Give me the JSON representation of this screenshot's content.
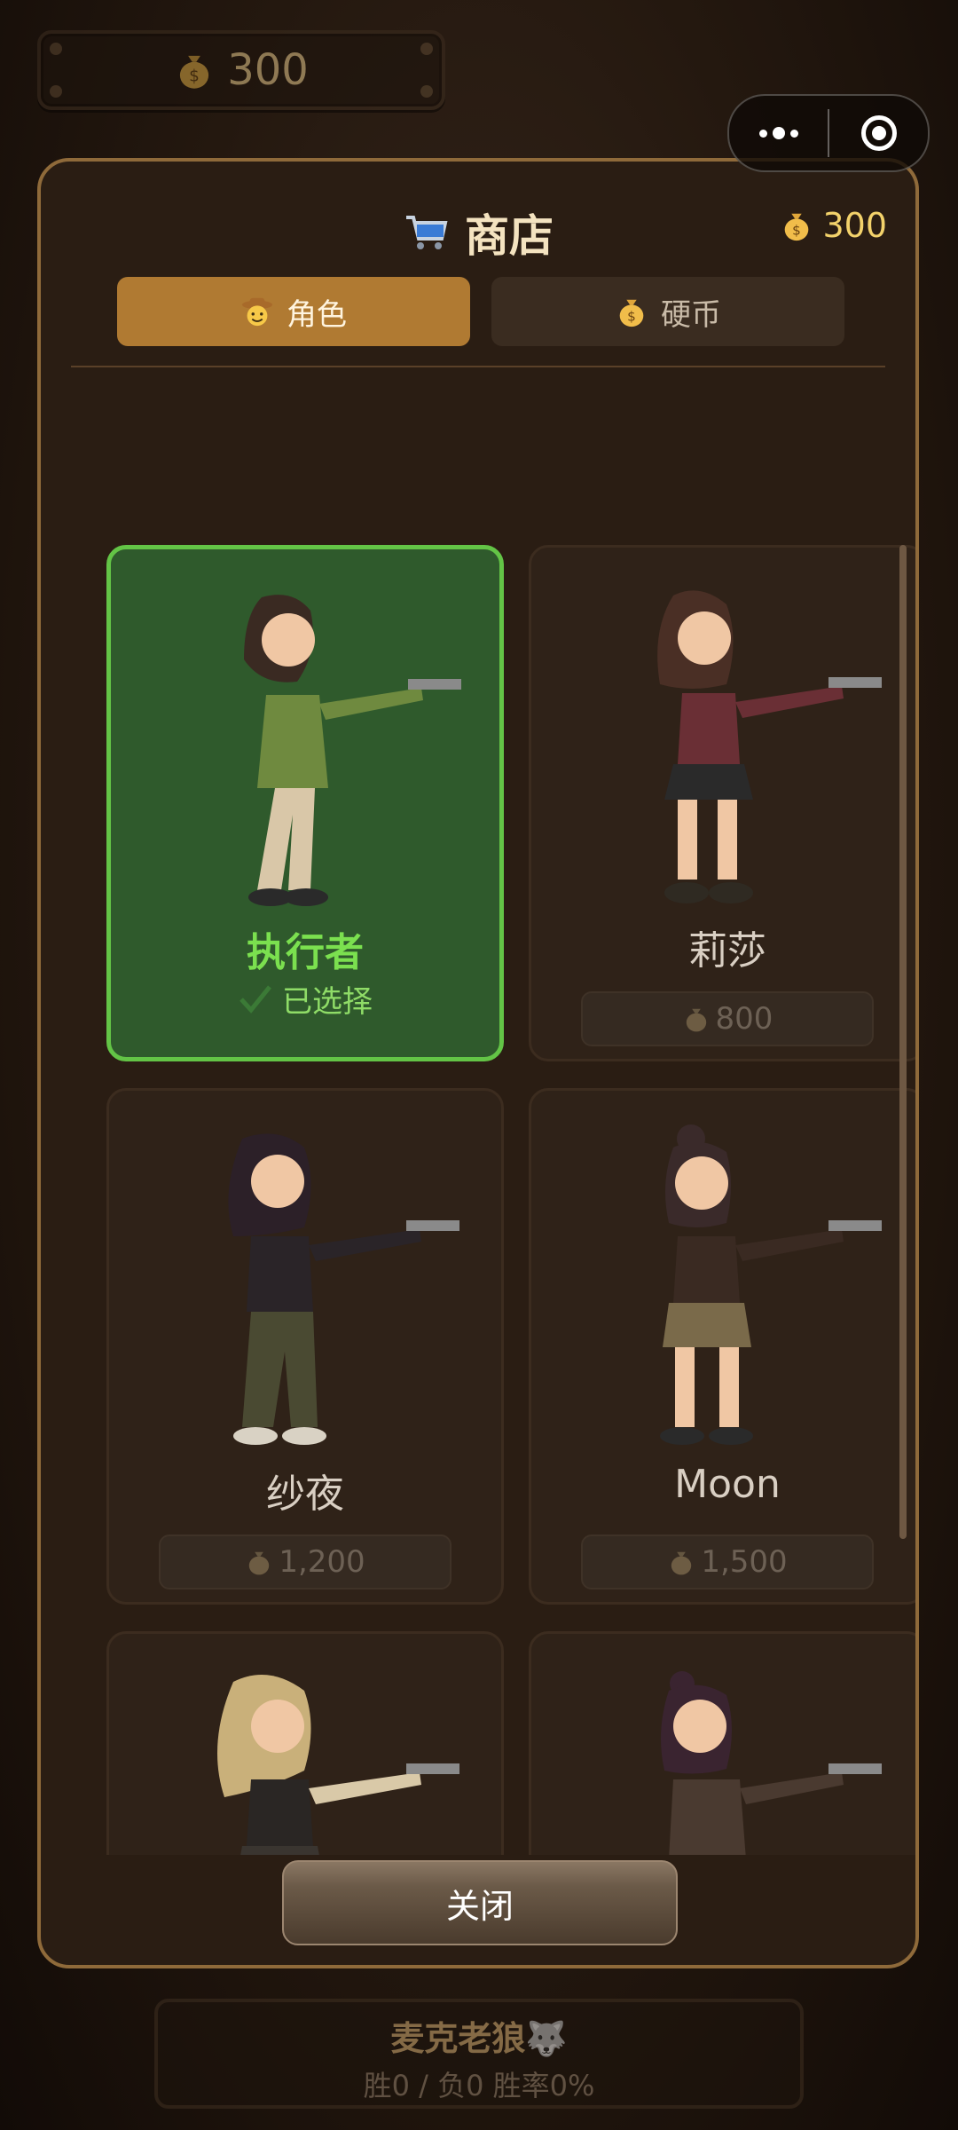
{
  "hud": {
    "coins": "300",
    "player_name": "麦克老狼🐺",
    "player_stats": "胜0 / 负0  胜率0%"
  },
  "shop": {
    "title": "商店",
    "balance": "300",
    "tabs": [
      {
        "label": "角色",
        "icon": "cowboy-face-icon",
        "active": true
      },
      {
        "label": "硬币",
        "icon": "money-bag-icon",
        "active": false
      }
    ],
    "characters": [
      {
        "name": "执行者",
        "status": "已选择",
        "selected": true,
        "outfit": "green jacket, beige pants"
      },
      {
        "name": "莉莎",
        "price": "800",
        "selected": false,
        "outfit": "plaid shirt, black skirt"
      },
      {
        "name": "纱夜",
        "price": "1,200",
        "selected": false,
        "outfit": "black jacket, cargo pants"
      },
      {
        "name": "Moon",
        "price": "1,500",
        "selected": false,
        "outfit": "leather jacket, khaki skirt"
      },
      {
        "name": "",
        "selected": false,
        "outfit": "blonde, black skirt"
      },
      {
        "name": "",
        "selected": false,
        "outfit": "dark robe, shorts"
      }
    ],
    "close_label": "关闭"
  },
  "colors": {
    "accent": "#b07a32",
    "selected_border": "#63c446",
    "coin_text": "#f3d26b"
  }
}
